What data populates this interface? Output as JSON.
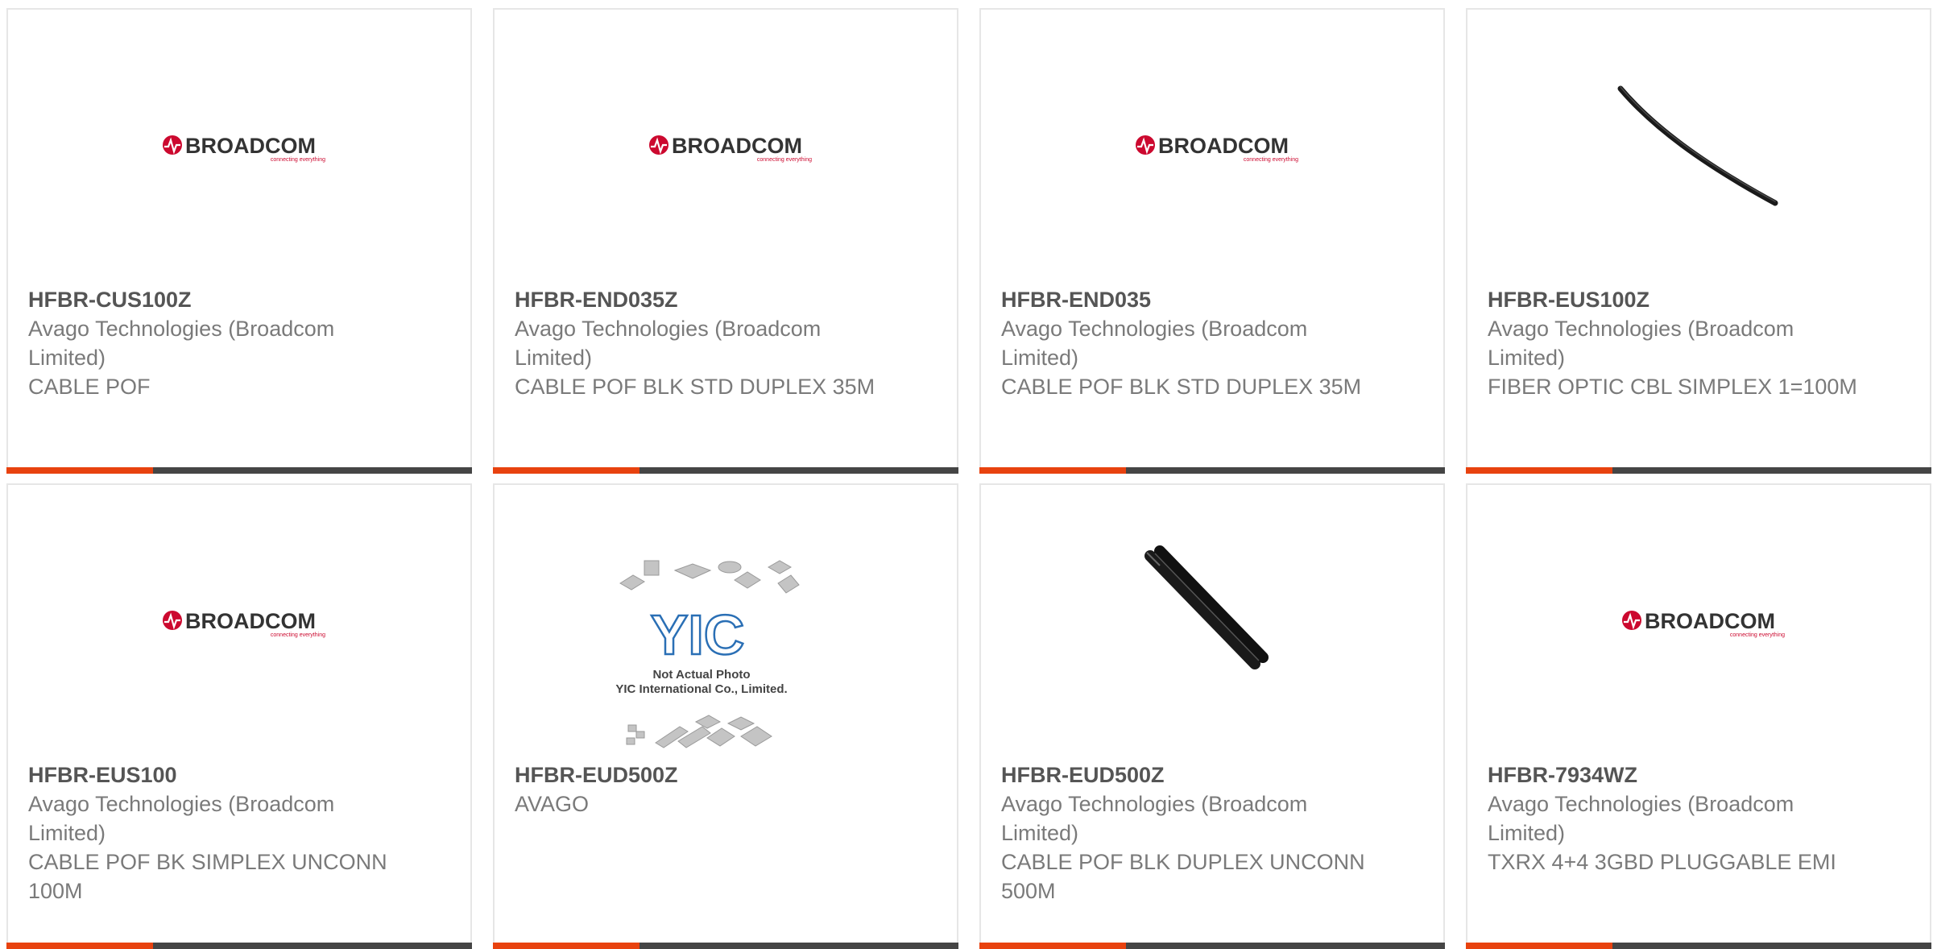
{
  "colors": {
    "accent": "#e8420f",
    "bar": "#454545",
    "broadcom_red": "#cc092f"
  },
  "products": [
    {
      "part_number": "HFBR-CUS100Z",
      "manufacturer": "Avago Technologies (Broadcom Limited)",
      "description": "CABLE POF",
      "image": "broadcom-logo",
      "logo_text": "BROADCOM",
      "logo_tagline": "connecting everything"
    },
    {
      "part_number": "HFBR-END035Z",
      "manufacturer": "Avago Technologies (Broadcom Limited)",
      "description": "CABLE POF BLK STD DUPLEX 35M",
      "image": "broadcom-logo",
      "logo_text": "BROADCOM",
      "logo_tagline": "connecting everything"
    },
    {
      "part_number": "HFBR-END035",
      "manufacturer": "Avago Technologies (Broadcom Limited)",
      "description": "CABLE POF BLK STD DUPLEX 35M",
      "image": "broadcom-logo",
      "logo_text": "BROADCOM",
      "logo_tagline": "connecting everything"
    },
    {
      "part_number": "HFBR-EUS100Z",
      "manufacturer": "Avago Technologies (Broadcom Limited)",
      "description": "FIBER OPTIC CBL SIMPLEX 1=100M",
      "image": "simplex-cable-photo"
    },
    {
      "part_number": "HFBR-EUS100",
      "manufacturer": "Avago Technologies (Broadcom Limited)",
      "description": "CABLE POF BK SIMPLEX UNCONN 100M",
      "image": "broadcom-logo",
      "logo_text": "BROADCOM",
      "logo_tagline": "connecting everything"
    },
    {
      "part_number": "HFBR-EUD500Z",
      "manufacturer": "AVAGO",
      "description": "",
      "image": "yic-placeholder",
      "placeholder_logo": "YIC",
      "placeholder_line1": "Not Actual Photo",
      "placeholder_line2": "YIC International Co., Limited."
    },
    {
      "part_number": "HFBR-EUD500Z",
      "manufacturer": "Avago Technologies (Broadcom Limited)",
      "description": "CABLE POF BLK DUPLEX UNCONN 500M",
      "image": "duplex-cable-photo"
    },
    {
      "part_number": "HFBR-7934WZ",
      "manufacturer": "Avago Technologies (Broadcom Limited)",
      "description": "TXRX 4+4 3GBD PLUGGABLE EMI",
      "image": "broadcom-logo",
      "logo_text": "BROADCOM",
      "logo_tagline": "connecting everything"
    }
  ]
}
